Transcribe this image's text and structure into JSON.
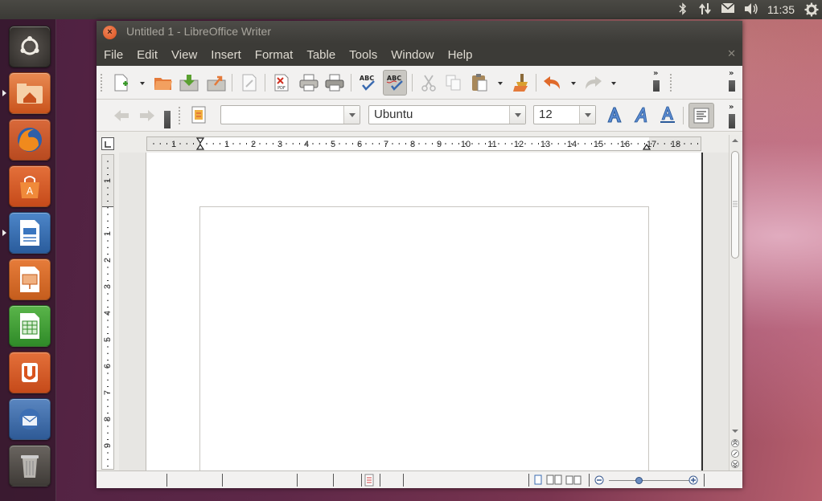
{
  "top_panel": {
    "clock": "11:35",
    "indicators": [
      "bluetooth-icon",
      "network-icon",
      "mail-icon",
      "volume-icon",
      "session-gear-icon"
    ]
  },
  "launcher": {
    "items": [
      "dash-home",
      "files",
      "firefox",
      "software-center",
      "libreoffice-writer",
      "libreoffice-impress",
      "libreoffice-calc",
      "ubuntu-one",
      "thunderbird",
      "trash"
    ]
  },
  "window": {
    "title": "Untitled 1 - LibreOffice Writer",
    "close_glyph": "×",
    "menu": [
      "File",
      "Edit",
      "View",
      "Insert",
      "Format",
      "Table",
      "Tools",
      "Window",
      "Help"
    ]
  },
  "formatting": {
    "style_value": "",
    "font_name": "Ubuntu",
    "font_size": "12"
  },
  "ruler": {
    "h_numbers": [
      "1",
      "1",
      "2",
      "3",
      "4",
      "5",
      "6",
      "7",
      "8",
      "9",
      "10",
      "11",
      "12",
      "13",
      "14",
      "15",
      "16",
      "17",
      "18"
    ],
    "v_numbers": [
      "1",
      "1",
      "2",
      "3",
      "4",
      "5",
      "6",
      "7",
      "8",
      "9"
    ]
  }
}
